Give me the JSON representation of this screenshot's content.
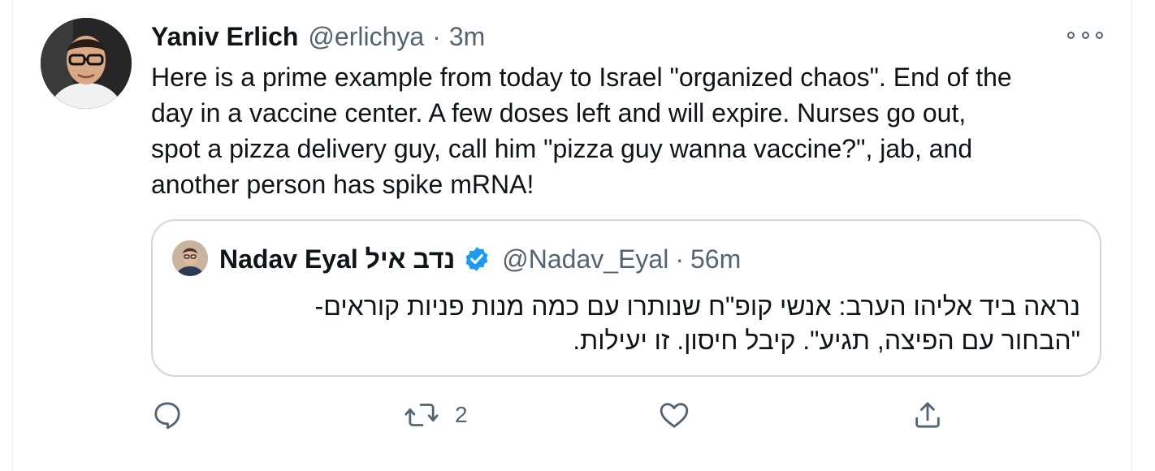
{
  "tweet": {
    "author_name": "Yaniv Erlich",
    "author_handle": "@erlichya",
    "separator": "·",
    "time": "3m",
    "text_lines": [
      "Here is a prime example from today to Israel \"organized chaos\". End of the",
      "day in a vaccine center. A few doses left and will expire. Nurses go out,",
      "spot a pizza delivery guy, call him \"pizza guy wanna vaccine?\", jab, and",
      "another person has spike mRNA!"
    ],
    "more_icon": "more-horizontal-icon",
    "avatar_icon": "user-avatar"
  },
  "quoted": {
    "author_name": "Nadav Eyal נדב איל",
    "verified_icon": "verified-badge-icon",
    "author_handle": "@Nadav_Eyal",
    "separator": "·",
    "time": "56m",
    "text_lines": [
      "נראה ביד אליהו הערב: אנשי קופ\"ח שנותרו עם כמה מנות פניות קוראים-",
      "\"הבחור עם הפיצה, תגיע\". קיבל חיסון. זו יעילות."
    ]
  },
  "actions": {
    "reply_icon": "reply-icon",
    "retweet_icon": "retweet-icon",
    "retweet_count": "2",
    "like_icon": "heart-icon",
    "share_icon": "share-icon"
  },
  "colors": {
    "text": "#0f1419",
    "secondary": "#536471",
    "border": "#cfd9de",
    "verified": "#1d9bf0"
  }
}
